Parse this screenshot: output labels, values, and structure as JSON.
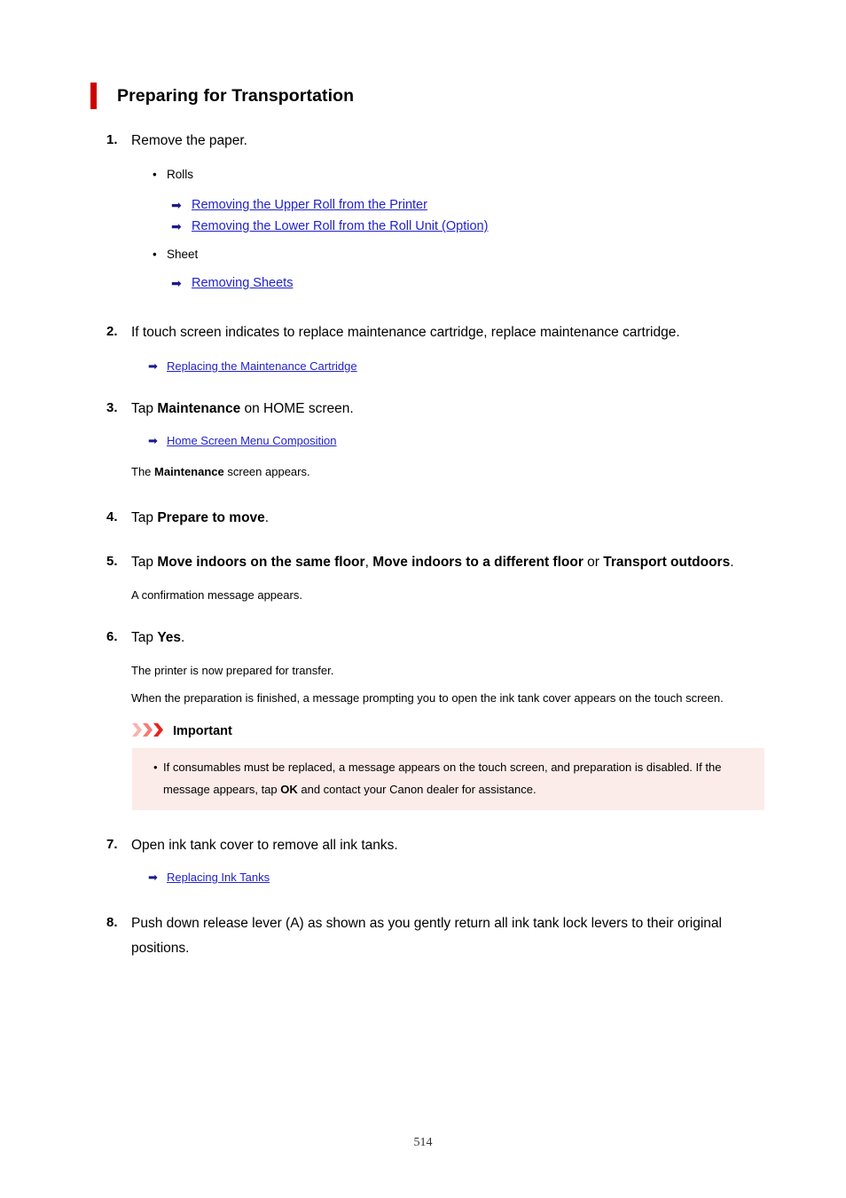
{
  "document": {
    "title": "Preparing for Transportation",
    "accent_color": "#cc0000",
    "page_number": "514"
  },
  "steps": [
    {
      "number": "1.",
      "text": "Remove the paper.",
      "groups": [
        {
          "bullet": "Rolls",
          "links": [
            "Removing the Upper Roll from the Printer",
            "Removing the Lower Roll from the Roll Unit (Option)"
          ]
        },
        {
          "bullet": "Sheet",
          "links": [
            "Removing Sheets"
          ]
        }
      ]
    },
    {
      "number": "2.",
      "text_parts": [
        {
          "t": "If touch screen indicates to replace maintenance cartridge, replace maintenance cartridge.",
          "b": false
        }
      ],
      "links": [
        "Replacing the Maintenance Cartridge"
      ]
    },
    {
      "number": "3.",
      "text_parts": [
        {
          "t": "Tap ",
          "b": false
        },
        {
          "t": "Maintenance",
          "b": true
        },
        {
          "t": " on HOME screen.",
          "b": false
        }
      ],
      "links": [
        "Home Screen Menu Composition"
      ],
      "note_parts": [
        {
          "t": "The ",
          "b": false
        },
        {
          "t": "Maintenance",
          "b": true
        },
        {
          "t": " screen appears.",
          "b": false
        }
      ]
    },
    {
      "number": "4.",
      "text_parts": [
        {
          "t": "Tap ",
          "b": false
        },
        {
          "t": "Prepare to move",
          "b": true
        },
        {
          "t": ".",
          "b": false
        }
      ]
    },
    {
      "number": "5.",
      "text_parts": [
        {
          "t": "Tap ",
          "b": false
        },
        {
          "t": "Move indoors on the same floor",
          "b": true
        },
        {
          "t": ", ",
          "b": false
        },
        {
          "t": "Move indoors to a different floor",
          "b": true
        },
        {
          "t": " or ",
          "b": false
        },
        {
          "t": "Transport outdoors",
          "b": true
        },
        {
          "t": ".",
          "b": false
        }
      ],
      "note": "A confirmation message appears."
    },
    {
      "number": "6.",
      "text_parts": [
        {
          "t": "Tap ",
          "b": false
        },
        {
          "t": "Yes",
          "b": true
        },
        {
          "t": ".",
          "b": false
        }
      ],
      "note1": "The printer is now prepared for transfer.",
      "note2": "When the preparation is finished, a message prompting you to open the ink tank cover appears on the touch screen."
    },
    {
      "number": "7.",
      "text": "Open ink tank cover to remove all ink tanks.",
      "links": [
        "Replacing Ink Tanks"
      ]
    },
    {
      "number": "8.",
      "text": "Push down release lever (A) as shown as you gently return all ink tank lock levers to their original positions."
    }
  ],
  "important": {
    "label": "Important",
    "background": "#fcece9",
    "chevron_colors": [
      "#f7b3ad",
      "#f77a74",
      "#e8231c"
    ],
    "bullet": "•",
    "item_parts": [
      {
        "t": "If consumables must be replaced, a message appears on the touch screen, and preparation is disabled. If the message appears, tap ",
        "b": false
      },
      {
        "t": "OK",
        "b": true
      },
      {
        "t": " and contact your Canon dealer for assistance.",
        "b": false
      }
    ]
  },
  "icons": {
    "link_arrow": "➡",
    "bullet_dot": "•"
  }
}
